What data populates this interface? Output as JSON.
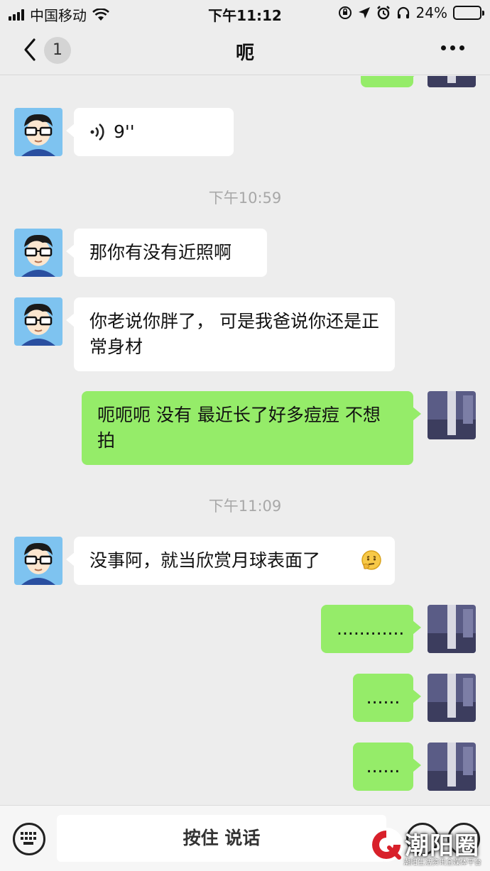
{
  "status_bar": {
    "carrier": "中国移动",
    "time": "下午11:12",
    "battery": "24%",
    "battery_level": 0.24
  },
  "nav": {
    "unread_count": "1",
    "title": "呃"
  },
  "messages": {
    "voice": {
      "duration": "9''"
    },
    "time1": "下午10:59",
    "m1": "那你有没有近照啊",
    "m2": "你老说你胖了， 可是我爸说你还是正常身材",
    "m3": "呃呃呃 没有 最近长了好多痘痘 不想拍",
    "time2": "下午11:09",
    "m4": "没事阿，就当欣赏月球表面了",
    "m5": "............",
    "m6": "......",
    "m7": "......"
  },
  "input_bar": {
    "hold_to_talk": "按住 说话"
  },
  "watermark": {
    "brand": "潮阳圈",
    "tagline": "潮阳生活资讯全媒体平台"
  },
  "colors": {
    "background": "#ededed",
    "outgoing_bubble": "#95ec69",
    "incoming_bubble": "#ffffff"
  }
}
